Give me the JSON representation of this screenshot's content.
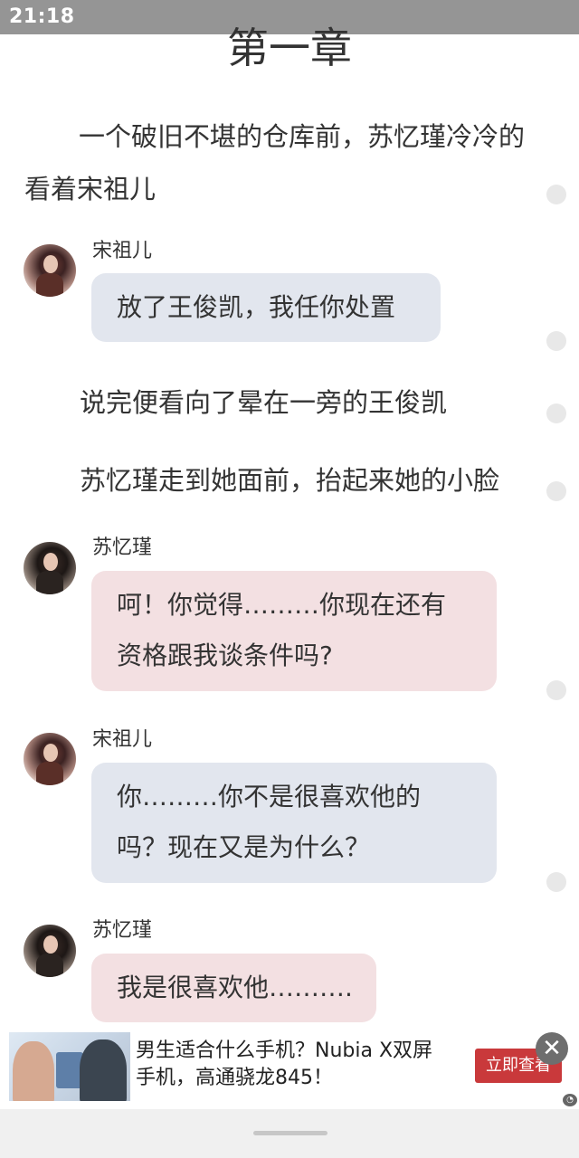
{
  "status_bar": {
    "time": "21:18"
  },
  "chapter": {
    "title": "第一章"
  },
  "narration": [
    "一个破旧不堪的仓库前，苏忆瑾冷冷的看着宋祖儿",
    "说完便看向了晕在一旁的王俊凯",
    "苏忆瑾走到她面前，抬起来她的小脸"
  ],
  "messages": [
    {
      "speaker": "宋祖儿",
      "bubble_color": "#e2e6ee",
      "lines": [
        "放了王俊凯，我任你处置"
      ]
    },
    {
      "speaker": "苏忆瑾",
      "bubble_color": "#f3e0e2",
      "lines": [
        "呵！你觉得………你现在还有",
        "资格跟我谈条件吗?"
      ]
    },
    {
      "speaker": "宋祖儿",
      "bubble_color": "#e2e6ee",
      "lines": [
        "你………你不是很喜欢他的",
        "吗？现在又是为什么？"
      ]
    },
    {
      "speaker": "苏忆瑾",
      "bubble_color": "#f3e0e2",
      "lines": [
        "我是很喜欢他………."
      ]
    }
  ],
  "ad": {
    "text_line_1": "男生适合什么手机？Nubia X双屏",
    "text_line_2": "手机，高通骁龙845！",
    "cta_label": "立即查看",
    "close_icon": "close-icon"
  },
  "colors": {
    "status_bar": "#959595",
    "bubble_blue": "#e2e6ee",
    "bubble_pink": "#f3e0e2",
    "cta": "#c9393b"
  }
}
